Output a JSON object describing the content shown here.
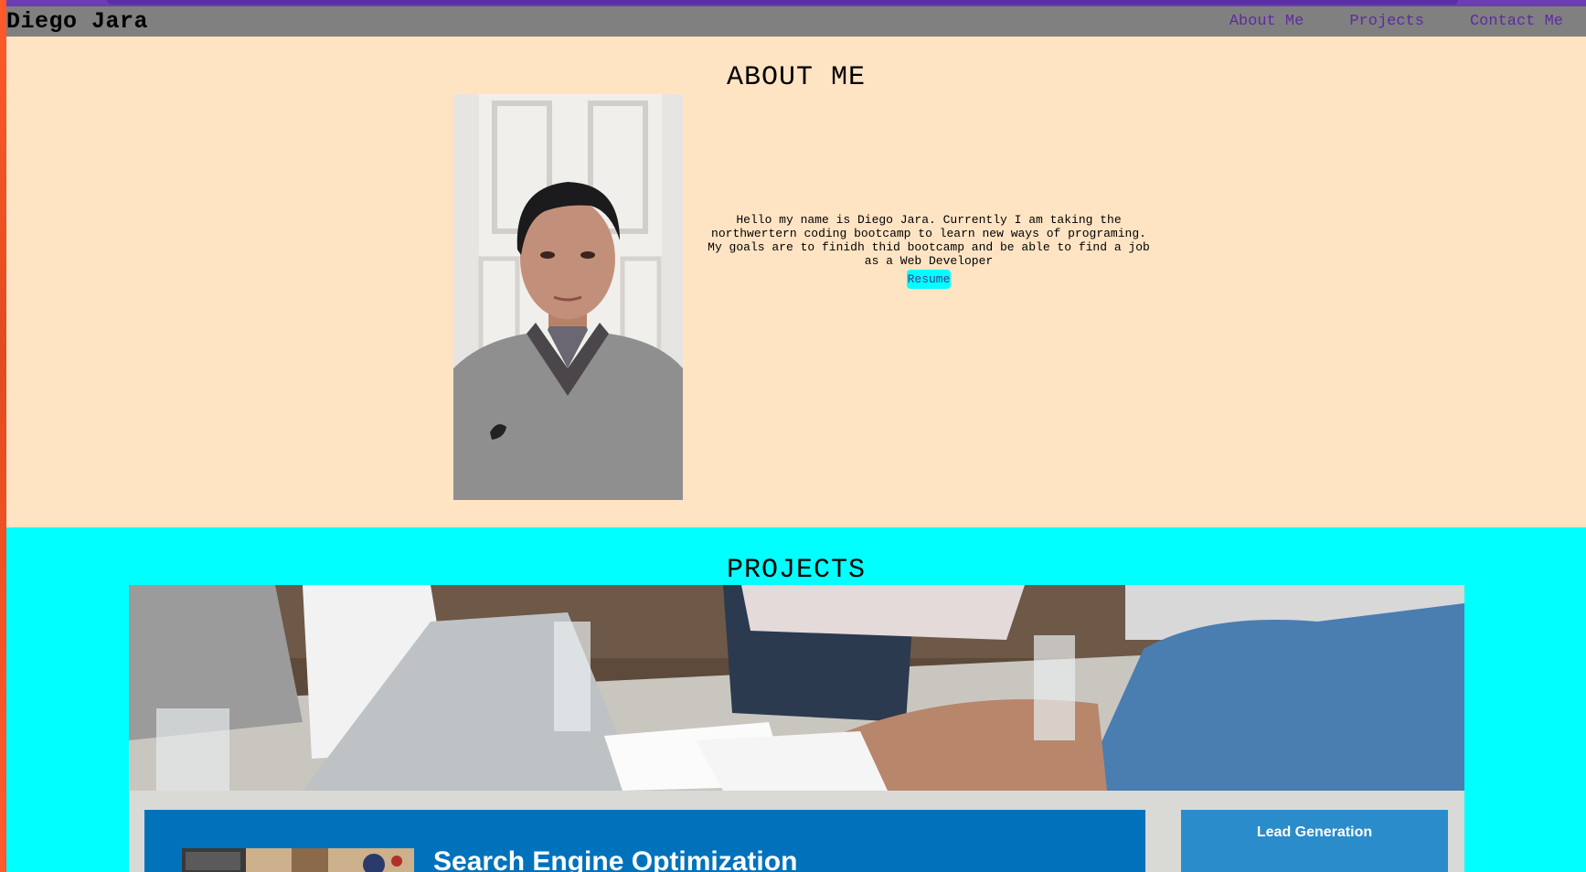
{
  "header": {
    "brand": "Diego Jara",
    "nav": [
      "About Me",
      "Projects",
      "Contact Me"
    ]
  },
  "about": {
    "title": "ABOUT ME",
    "bio": "Hello my name is Diego Jara. Currently I am taking the northwertern coding bootcamp to learn new ways of programing. My goals are to finidh thid bootcamp and be able to find a job as a Web Developer",
    "resume_label": "Resume"
  },
  "projects": {
    "title": "PROJECTS",
    "cards": [
      {
        "title": "Search Engine Optimization"
      },
      {
        "title": "Lead Generation"
      }
    ]
  },
  "colors": {
    "header_bg": "#808080",
    "nav_link": "#5b2ca0",
    "about_bg": "#ffe4c4",
    "projects_bg": "#00ffff",
    "resume_bg": "#00ffff",
    "seo_card": "#0072bc",
    "lead_card": "#2a8ccb"
  }
}
